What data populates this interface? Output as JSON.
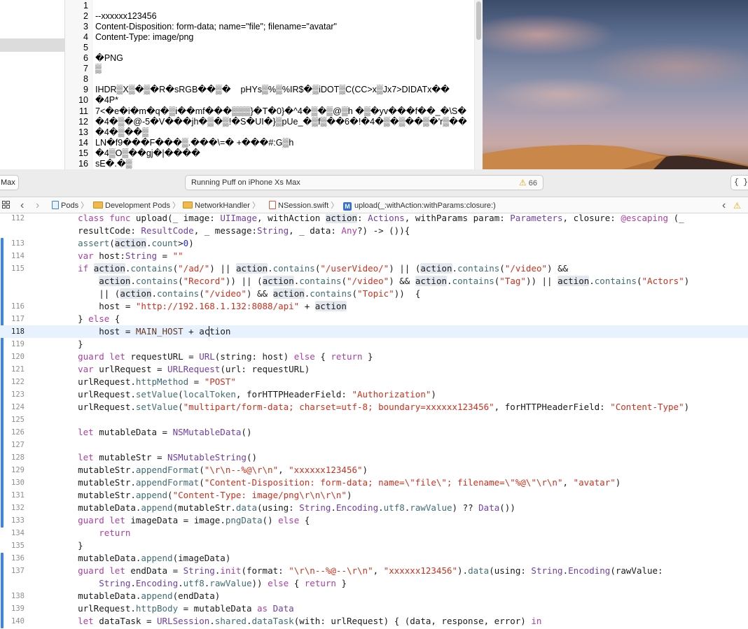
{
  "text_view": {
    "lines": [
      {
        "num": "1",
        "text": ""
      },
      {
        "num": "2",
        "text": "--xxxxxx123456"
      },
      {
        "num": "3",
        "text": "Content-Disposition: form-data; name=\"file\"; filename=\"avatar\""
      },
      {
        "num": "4",
        "text": "Content-Type: image/png"
      },
      {
        "num": "5",
        "text": ""
      },
      {
        "num": "6",
        "text": "�PNG"
      },
      {
        "num": "7",
        "text": "▒"
      },
      {
        "num": "8",
        "text": ""
      },
      {
        "num": "9",
        "text": "IHDR▒X▒�▒�R�sRGB��▒�    pHYs▒%▒%IR$�▒iDOT▒C(CC>x▒Jx7>DIDATx��"
      },
      {
        "num": "10",
        "text": "�4P*"
      },
      {
        "num": "11",
        "text": "7<�e�i�m�q�▒i��mf���▒▒▒}�T�0}�^4�▒�▒@▒h �▒�yv���f��_�\\S�"
      },
      {
        "num": "12",
        "text": "�4�▒�@-5�V���jh�▒�▒!�S�UI�}▒pUe_�▒f▒��6�!�4�▒�▒��▒�'r▒��"
      },
      {
        "num": "13",
        "text": "�4�▒��▒"
      },
      {
        "num": "14",
        "text": "LN�f9���F���▒.���\\=� +���#:G▒h"
      },
      {
        "num": "15",
        "text": "�4▒O▒��gj�|����"
      },
      {
        "num": "16",
        "text": "sE�.�▒"
      }
    ]
  },
  "toolbar": {
    "scheme_label": "Max",
    "activity_text": "Running Puff on iPhone Xs Max",
    "warning_count": "66",
    "warning_symbol": "⚠",
    "braces_label": "{ }"
  },
  "jumpbar": {
    "back": "‹",
    "forward": "›",
    "items": [
      "Pods",
      "Development Pods",
      "NetworkHandler",
      "NSession.swift",
      "upload(_:withAction:withParams:closure:)"
    ],
    "method_badge": "M",
    "right_chevron": "‹",
    "warning_symbol": "⚠"
  },
  "editor": {
    "current_line": "118",
    "line_numbers": [
      "112",
      "",
      "113",
      "114",
      "115",
      "",
      "",
      "116",
      "117",
      "118",
      "119",
      "120",
      "121",
      "122",
      "123",
      "124",
      "125",
      "126",
      "127",
      "128",
      "129",
      "130",
      "131",
      "132",
      "133",
      "134",
      "135",
      "136",
      "137",
      "",
      "138",
      "139",
      "140"
    ]
  }
}
